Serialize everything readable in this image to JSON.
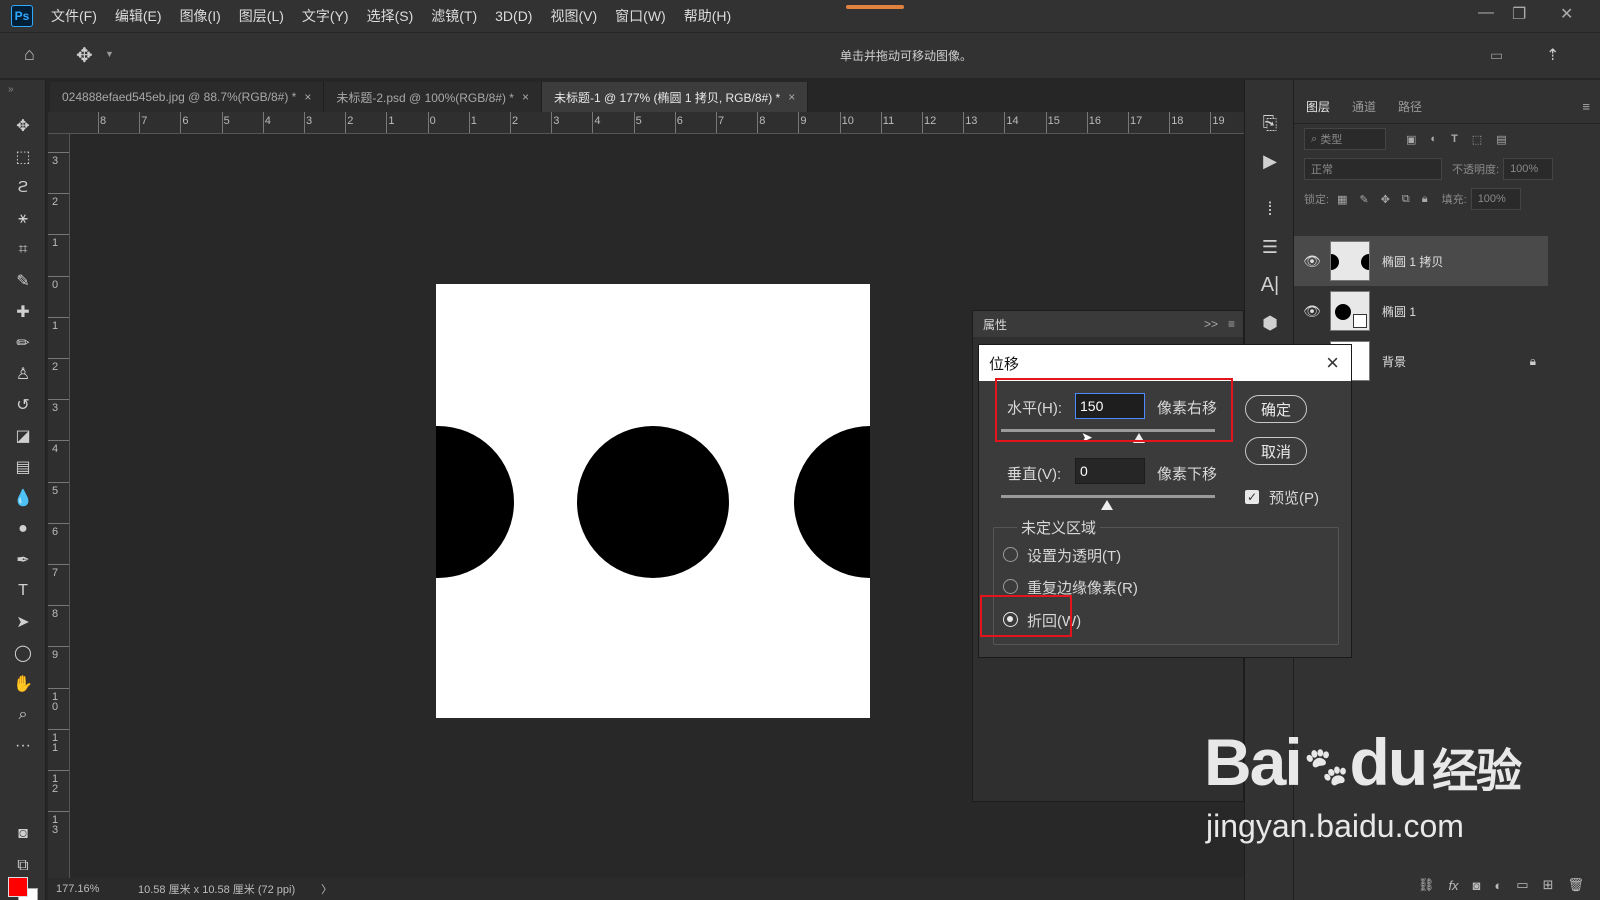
{
  "app": {
    "logo": "Ps"
  },
  "menu": [
    "文件(F)",
    "编辑(E)",
    "图像(I)",
    "图层(L)",
    "文字(Y)",
    "选择(S)",
    "滤镜(T)",
    "3D(D)",
    "视图(V)",
    "窗口(W)",
    "帮助(H)"
  ],
  "progress_fraction": 1.0,
  "options": {
    "hint": "单击并拖动可移动图像。"
  },
  "tabs": [
    {
      "label": "024888efaed545eb.jpg @ 88.7%(RGB/8#) *",
      "close": "×"
    },
    {
      "label": "未标题-2.psd @ 100%(RGB/8#) *",
      "close": "×"
    },
    {
      "label": "未标题-1 @ 177% (椭圆 1 拷贝, RGB/8#) *",
      "close": "×"
    }
  ],
  "ruler": {
    "h_ticks": [
      "8",
      "7",
      "6",
      "5",
      "4",
      "3",
      "2",
      "1",
      "0",
      "1",
      "2",
      "3",
      "4",
      "5",
      "6",
      "7",
      "8",
      "9",
      "10",
      "11",
      "12",
      "13",
      "14",
      "15",
      "16",
      "17",
      "18",
      "19"
    ],
    "v_ticks": [
      "3",
      "2",
      "1",
      "0",
      "1",
      "2",
      "3",
      "4",
      "5",
      "6",
      "7",
      "8",
      "9",
      "10",
      "11",
      "12",
      "13"
    ]
  },
  "status": {
    "zoom": "177.16%",
    "doc_size": "10.58 厘米 x 10.58 厘米 (72 ppi)",
    "arrow": "〉"
  },
  "layers_panel": {
    "tabs": [
      "图层",
      "通道",
      "路径"
    ],
    "filter_label": "类型",
    "blend_mode": "正常",
    "opacity_label": "不透明度:",
    "opacity_value": "100%",
    "lock_label": "锁定:",
    "fill_label": "填充:",
    "fill_value": "100%",
    "layers": [
      {
        "name": "椭圆 1 拷贝",
        "selected": true
      },
      {
        "name": "椭圆 1",
        "selected": false
      },
      {
        "name": "背景",
        "selected": false
      }
    ]
  },
  "properties_panel": {
    "title": "属性",
    "expand": ">>"
  },
  "dialog": {
    "title": "位移",
    "horizontal_label": "水平(H):",
    "horizontal_value": "150",
    "horizontal_unit": "像素右移",
    "vertical_label": "垂直(V):",
    "vertical_value": "0",
    "vertical_unit": "像素下移",
    "ok": "确定",
    "cancel": "取消",
    "preview_label": "预览(P)",
    "preview_checked": true,
    "undefined_area_label": "未定义区域",
    "options": [
      {
        "label": "设置为透明(T)",
        "selected": false
      },
      {
        "label": "重复边缘像素(R)",
        "selected": false
      },
      {
        "label": "折回(W)",
        "selected": true
      }
    ]
  },
  "watermark": {
    "brand": "Bai",
    "brand2": "du",
    "cn": "经验",
    "url": "jingyan.baidu.com"
  },
  "colors": {
    "foreground": "#ff0000",
    "background": "#ffffff",
    "highlight": "#e3141b",
    "accent": "#31a8ff"
  }
}
